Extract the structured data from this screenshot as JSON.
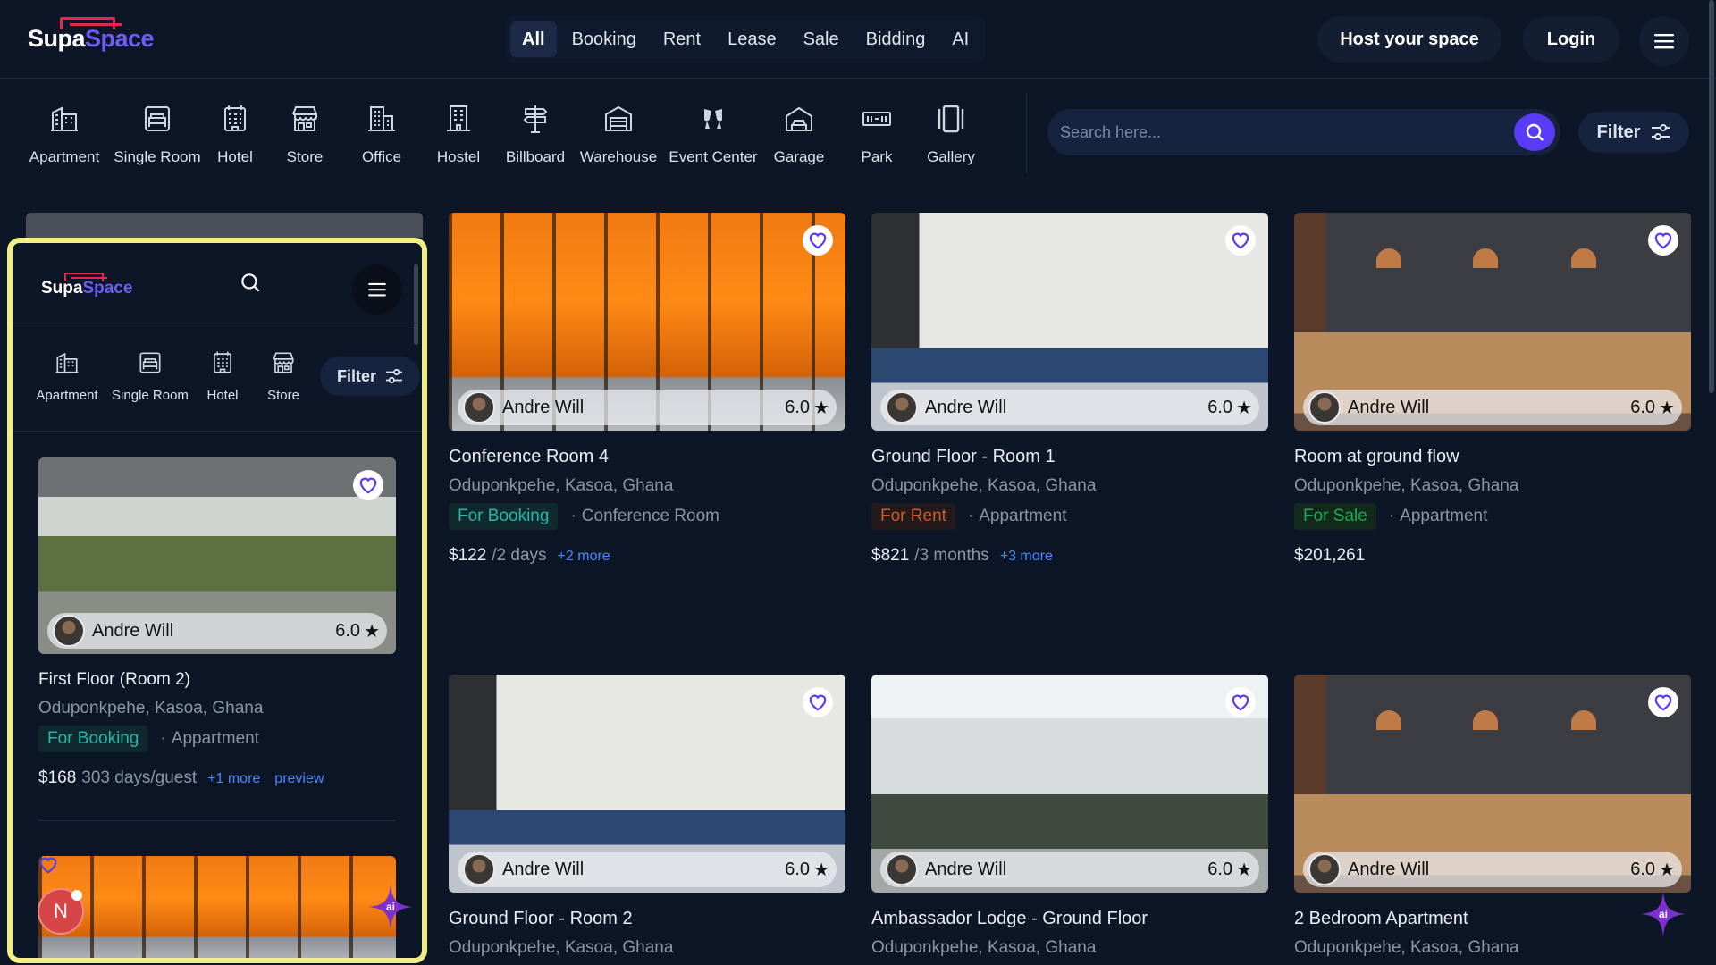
{
  "header": {
    "logo_a": "Supa",
    "logo_b": "Space",
    "tabs": [
      "All",
      "Booking",
      "Rent",
      "Lease",
      "Sale",
      "Bidding",
      "AI"
    ],
    "host_label": "Host your space",
    "login_label": "Login"
  },
  "categories": [
    "Apartment",
    "Single Room",
    "Hotel",
    "Store",
    "Office",
    "Hostel",
    "Billboard",
    "Warehouse",
    "Event Center",
    "Garage",
    "Park",
    "Gallery"
  ],
  "search": {
    "placeholder": "Search here..."
  },
  "filter_label": "Filter",
  "cards": [
    {
      "host": "Andre Will",
      "rating": "6.0",
      "title": "Conference Room 4",
      "location": "Oduponkpehe, Kasoa, Ghana",
      "badge": "For Booking",
      "category": "Conference Room",
      "price": "$122",
      "per": "/2 days",
      "more": "+2 more"
    },
    {
      "host": "Andre Will",
      "rating": "6.0",
      "title": "Ground Floor - Room 1",
      "location": "Oduponkpehe, Kasoa, Ghana",
      "badge": "For Rent",
      "category": "Appartment",
      "price": "$821",
      "per": "/3 months",
      "more": "+3 more"
    },
    {
      "host": "Andre Will",
      "rating": "6.0",
      "title": "Room at ground flow",
      "location": "Oduponkpehe, Kasoa, Ghana",
      "badge": "For Sale",
      "category": "Appartment",
      "price": "$201,261"
    },
    {
      "host": "Andre Will",
      "rating": "6.0",
      "title": "Ground Floor - Room 2",
      "location": "Oduponkpehe, Kasoa, Ghana"
    },
    {
      "host": "Andre Will",
      "rating": "6.0",
      "title": "Ambassador Lodge - Ground Floor",
      "location": "Oduponkpehe, Kasoa, Ghana"
    },
    {
      "host": "Andre Will",
      "rating": "6.0",
      "title": "2 Bedroom Apartment",
      "location": "Oduponkpehe, Kasoa, Ghana"
    }
  ],
  "mobile": {
    "categories": [
      "Apartment",
      "Single Room",
      "Hotel",
      "Store"
    ],
    "filter_label": "Filter",
    "card": {
      "host": "Andre Will",
      "rating": "6.0",
      "title": "First Floor (Room 2)",
      "location": "Oduponkpehe, Kasoa, Ghana",
      "badge": "For Booking",
      "category": "Appartment",
      "price": "$168",
      "per": "303 days/guest",
      "more": "+1 more",
      "preview": "preview"
    }
  },
  "user_initial": "N",
  "ai_label": "ai",
  "colors": {
    "accent": "#5b3cf6",
    "logo_red": "#e5264d",
    "booking": "#25b7a8",
    "rent": "#cf5c2a",
    "sale": "#1fa855",
    "link": "#4a86ff"
  }
}
